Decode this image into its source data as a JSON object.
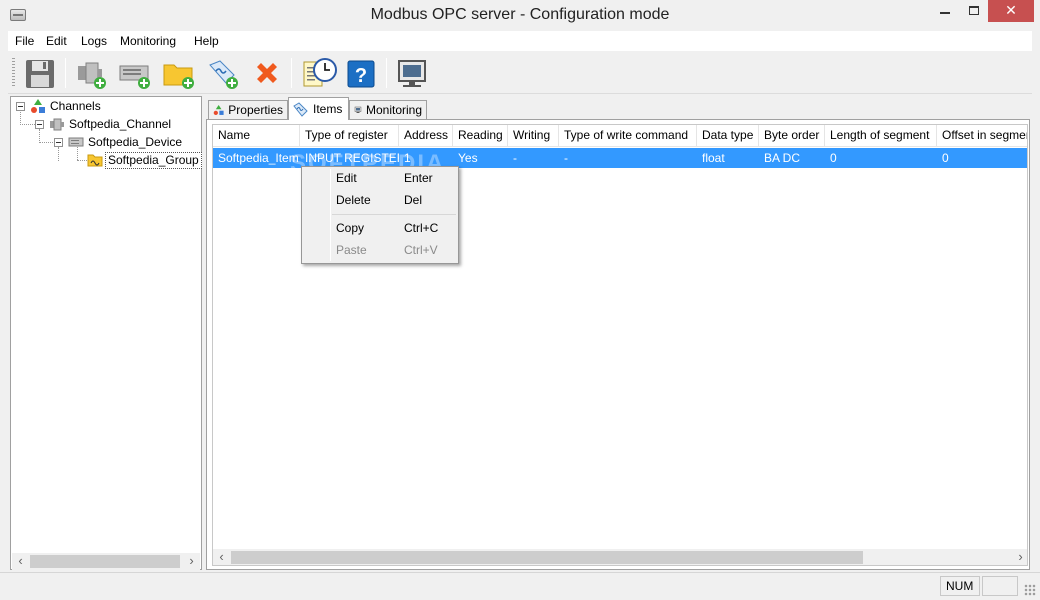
{
  "window": {
    "title": "Modbus OPC server - Configuration mode",
    "close_glyph": "✕"
  },
  "menu": [
    "File",
    "Edit",
    "Logs",
    "Monitoring",
    "Help"
  ],
  "toolbar": {
    "icons": [
      "save-icon",
      "add-channel-icon",
      "add-device-icon",
      "add-group-icon",
      "add-item-icon",
      "delete-icon",
      "notes-icon",
      "clock-icon",
      "help-icon",
      "monitor-icon"
    ]
  },
  "tree": {
    "nodes": [
      "Channels",
      "Softpedia_Channel",
      "Softpedia_Device",
      "Softpedia_Group"
    ],
    "selected": "Softpedia_Group"
  },
  "tabs": [
    "Properties",
    "Items",
    "Monitoring"
  ],
  "active_tab": "Items",
  "grid": {
    "columns": [
      "Name",
      "Type of register",
      "Address",
      "Reading",
      "Writing",
      "Type of write command",
      "Data type",
      "Byte order",
      "Length of segment",
      "Offset in segment"
    ],
    "rows": [
      [
        "Softpedia_Item",
        "INPUT REGISTER",
        "1",
        "Yes",
        "-",
        "-",
        "float",
        "BA DC",
        "0",
        "0"
      ]
    ]
  },
  "context_menu": {
    "items": [
      {
        "label": "Edit",
        "shortcut": "Enter",
        "enabled": true
      },
      {
        "label": "Delete",
        "shortcut": "Del",
        "enabled": true
      },
      {
        "label": "Copy",
        "shortcut": "Ctrl+C",
        "enabled": true
      },
      {
        "label": "Paste",
        "shortcut": "Ctrl+V",
        "enabled": false
      }
    ]
  },
  "status": {
    "num": "NUM"
  },
  "watermark": "SOFTPEDIA",
  "colors": {
    "selection": "#3399ff",
    "close_button": "#c75050",
    "delete_icon": "#f05a1e",
    "folder_icon": "#f7c631",
    "help_icon": "#1c6fc4"
  }
}
